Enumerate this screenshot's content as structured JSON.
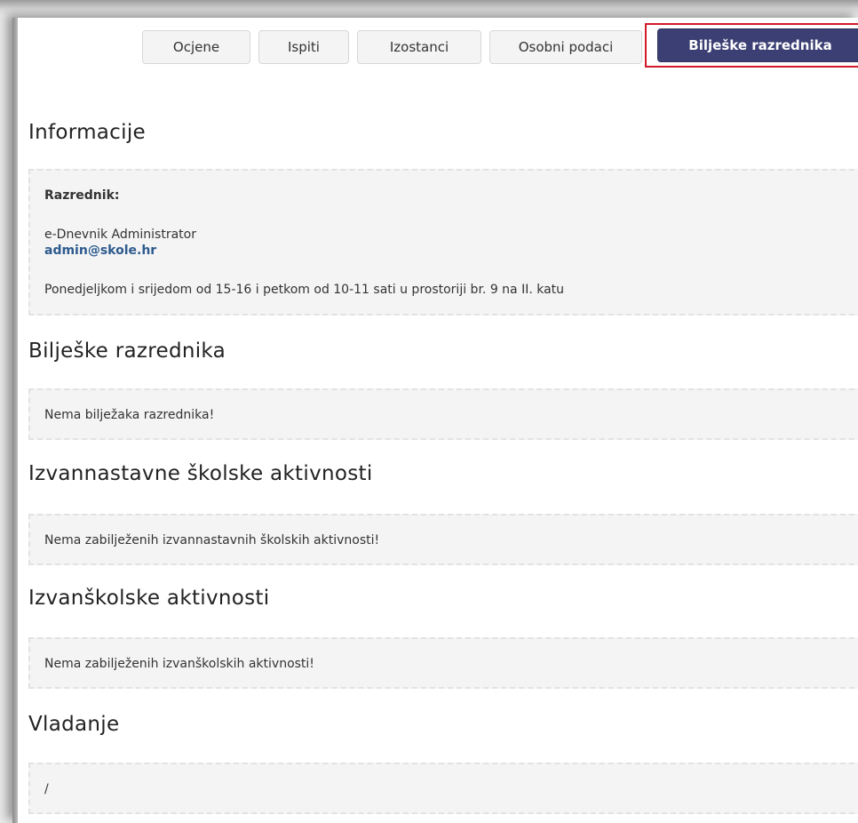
{
  "tabs": [
    {
      "label": "Ocjene"
    },
    {
      "label": "Ispiti"
    },
    {
      "label": "Izostanci"
    },
    {
      "label": "Osobni podaci"
    },
    {
      "label": "Bilješke razrednika",
      "active": true
    }
  ],
  "informacije": {
    "title": "Informacije",
    "razrednik_label": "Razrednik:",
    "name": "e-Dnevnik Administrator",
    "email": "admin@skole.hr",
    "hours": "Ponedjeljkom i srijedom od 15-16 i petkom od 10-11 sati u prostoriji br. 9 na II. katu"
  },
  "biljeske": {
    "title": "Bilješke razrednika",
    "text": "Nema bilježaka razrednika!"
  },
  "izvannastavne": {
    "title": "Izvannastavne školske aktivnosti",
    "text": "Nema zabilježenih izvannastavnih školskih aktivnosti!"
  },
  "izvanskolske": {
    "title": "Izvanškolske aktivnosti",
    "text": "Nema zabilježenih izvanškolskih aktivnosti!"
  },
  "vladanje": {
    "title": "Vladanje",
    "text": "/"
  },
  "colors": {
    "active_tab_bg": "#3b3f73",
    "highlight_border": "#d21a2a",
    "link": "#2d5a8e",
    "box_bg": "#f4f4f4"
  }
}
